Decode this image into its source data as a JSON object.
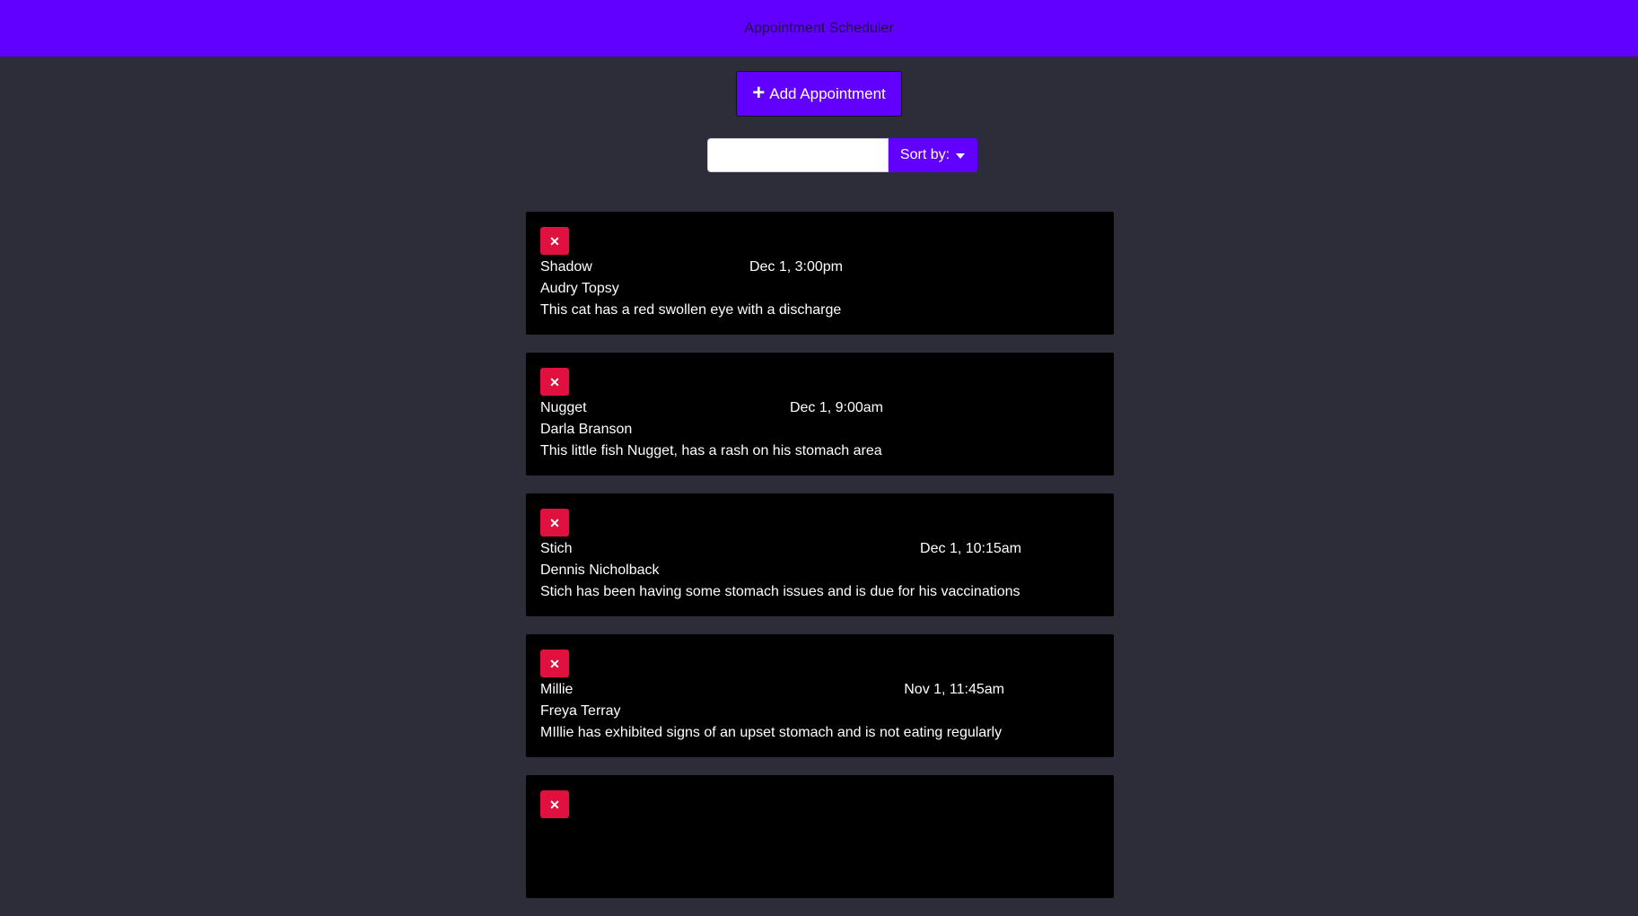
{
  "header": {
    "title": "Appointment Scheduler"
  },
  "add_button": {
    "label": "Add Appointment",
    "icon": "plus-icon"
  },
  "search": {
    "value": "",
    "placeholder": ""
  },
  "sort_button": {
    "label": "Sort by:"
  },
  "colors": {
    "brand": "#6200ff",
    "background": "#2d2d3a",
    "card": "#000000",
    "delete": "#e0103f"
  },
  "appointments": [
    {
      "pet_name": "Shadow",
      "date": "Dec 1, 3:00pm",
      "owner": "Audry Topsy",
      "notes": "This cat has a red swollen eye with a discharge"
    },
    {
      "pet_name": "Nugget",
      "date": "Dec 1, 9:00am",
      "owner": "Darla Branson",
      "notes": "This little fish Nugget, has a rash on his stomach area"
    },
    {
      "pet_name": "Stich",
      "date": "Dec 1, 10:15am",
      "owner": "Dennis Nicholback",
      "notes": "Stich has been having some stomach issues and is due for his vaccinations"
    },
    {
      "pet_name": "Millie",
      "date": "Nov 1, 11:45am",
      "owner": "Freya Terray",
      "notes": "MIllie has exhibited signs of an upset stomach and is not eating regularly"
    }
  ]
}
